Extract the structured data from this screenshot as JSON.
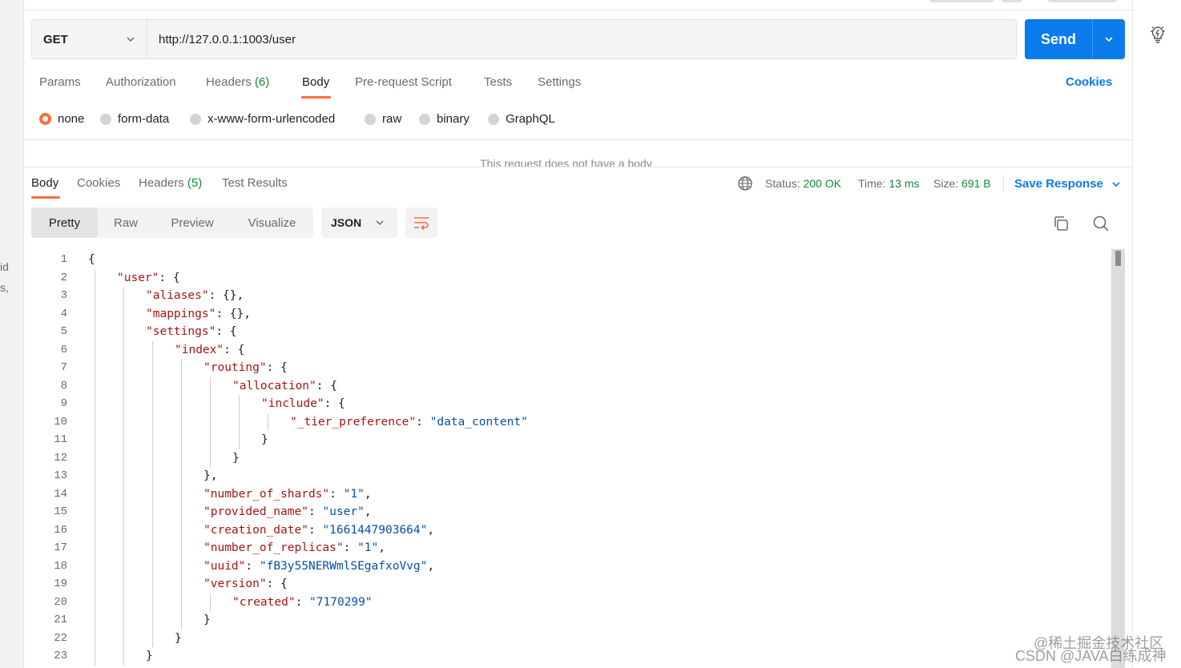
{
  "left_gutter": {
    "fragments": [
      "id",
      "s,"
    ]
  },
  "request": {
    "method": "GET",
    "url": "http://127.0.0.1:1003/user",
    "send_label": "Send"
  },
  "request_tabs": [
    {
      "label": "Params",
      "count": ""
    },
    {
      "label": "Authorization",
      "count": ""
    },
    {
      "label": "Headers",
      "count": "(6)"
    },
    {
      "label": "Body",
      "count": ""
    },
    {
      "label": "Pre-request Script",
      "count": ""
    },
    {
      "label": "Tests",
      "count": ""
    },
    {
      "label": "Settings",
      "count": ""
    }
  ],
  "active_request_tab": "Body",
  "cookies_label": "Cookies",
  "body_types": [
    "none",
    "form-data",
    "x-www-form-urlencoded",
    "raw",
    "binary",
    "GraphQL"
  ],
  "selected_body_type": "none",
  "no_body_message": "This request does not have a body",
  "response_tabs": [
    {
      "label": "Body",
      "count": ""
    },
    {
      "label": "Cookies",
      "count": ""
    },
    {
      "label": "Headers",
      "count": "(5)"
    },
    {
      "label": "Test Results",
      "count": ""
    }
  ],
  "active_response_tab": "Body",
  "response_meta": {
    "status_label": "Status:",
    "status_value": "200 OK",
    "time_label": "Time:",
    "time_value": "13 ms",
    "size_label": "Size:",
    "size_value": "691 B"
  },
  "save_response_label": "Save Response",
  "view_modes": [
    "Pretty",
    "Raw",
    "Preview",
    "Visualize"
  ],
  "active_view_mode": "Pretty",
  "format": "JSON",
  "code_lines": [
    {
      "n": "1",
      "indent": 0,
      "tokens": [
        [
          "p",
          "{"
        ]
      ]
    },
    {
      "n": "2",
      "indent": 1,
      "tokens": [
        [
          "k",
          "\"user\""
        ],
        [
          "p",
          ": {"
        ]
      ]
    },
    {
      "n": "3",
      "indent": 2,
      "tokens": [
        [
          "k",
          "\"aliases\""
        ],
        [
          "p",
          ": {},"
        ]
      ]
    },
    {
      "n": "4",
      "indent": 2,
      "tokens": [
        [
          "k",
          "\"mappings\""
        ],
        [
          "p",
          ": {},"
        ]
      ]
    },
    {
      "n": "5",
      "indent": 2,
      "tokens": [
        [
          "k",
          "\"settings\""
        ],
        [
          "p",
          ": {"
        ]
      ]
    },
    {
      "n": "6",
      "indent": 3,
      "tokens": [
        [
          "k",
          "\"index\""
        ],
        [
          "p",
          ": {"
        ]
      ]
    },
    {
      "n": "7",
      "indent": 4,
      "tokens": [
        [
          "k",
          "\"routing\""
        ],
        [
          "p",
          ": {"
        ]
      ]
    },
    {
      "n": "8",
      "indent": 5,
      "tokens": [
        [
          "k",
          "\"allocation\""
        ],
        [
          "p",
          ": {"
        ]
      ]
    },
    {
      "n": "9",
      "indent": 6,
      "tokens": [
        [
          "k",
          "\"include\""
        ],
        [
          "p",
          ": {"
        ]
      ]
    },
    {
      "n": "10",
      "indent": 7,
      "tokens": [
        [
          "k",
          "\"_tier_preference\""
        ],
        [
          "p",
          ": "
        ],
        [
          "s",
          "\"data_content\""
        ]
      ]
    },
    {
      "n": "11",
      "indent": 6,
      "tokens": [
        [
          "p",
          "}"
        ]
      ]
    },
    {
      "n": "12",
      "indent": 5,
      "tokens": [
        [
          "p",
          "}"
        ]
      ]
    },
    {
      "n": "13",
      "indent": 4,
      "tokens": [
        [
          "p",
          "},"
        ]
      ]
    },
    {
      "n": "14",
      "indent": 4,
      "tokens": [
        [
          "k",
          "\"number_of_shards\""
        ],
        [
          "p",
          ": "
        ],
        [
          "s",
          "\"1\""
        ],
        [
          "p",
          ","
        ]
      ]
    },
    {
      "n": "15",
      "indent": 4,
      "tokens": [
        [
          "k",
          "\"provided_name\""
        ],
        [
          "p",
          ": "
        ],
        [
          "s",
          "\"user\""
        ],
        [
          "p",
          ","
        ]
      ]
    },
    {
      "n": "16",
      "indent": 4,
      "tokens": [
        [
          "k",
          "\"creation_date\""
        ],
        [
          "p",
          ": "
        ],
        [
          "s",
          "\"1661447903664\""
        ],
        [
          "p",
          ","
        ]
      ]
    },
    {
      "n": "17",
      "indent": 4,
      "tokens": [
        [
          "k",
          "\"number_of_replicas\""
        ],
        [
          "p",
          ": "
        ],
        [
          "s",
          "\"1\""
        ],
        [
          "p",
          ","
        ]
      ]
    },
    {
      "n": "18",
      "indent": 4,
      "tokens": [
        [
          "k",
          "\"uuid\""
        ],
        [
          "p",
          ": "
        ],
        [
          "s",
          "\"fB3y55NERWmlSEgafxoVvg\""
        ],
        [
          "p",
          ","
        ]
      ]
    },
    {
      "n": "19",
      "indent": 4,
      "tokens": [
        [
          "k",
          "\"version\""
        ],
        [
          "p",
          ": {"
        ]
      ]
    },
    {
      "n": "20",
      "indent": 5,
      "tokens": [
        [
          "k",
          "\"created\""
        ],
        [
          "p",
          ": "
        ],
        [
          "s",
          "\"7170299\""
        ]
      ]
    },
    {
      "n": "21",
      "indent": 4,
      "tokens": [
        [
          "p",
          "}"
        ]
      ]
    },
    {
      "n": "22",
      "indent": 3,
      "tokens": [
        [
          "p",
          "}"
        ]
      ]
    },
    {
      "n": "23",
      "indent": 2,
      "tokens": [
        [
          "p",
          "}"
        ]
      ]
    }
  ],
  "watermark": {
    "line1": "@稀土掘金技术社区",
    "line2": "CSDN @JAVA白练成神"
  },
  "colors": {
    "accent": "#ff6c37",
    "link": "#097bed",
    "success": "#0f8a3c",
    "json_key": "#a31515",
    "json_string": "#0451a5"
  }
}
